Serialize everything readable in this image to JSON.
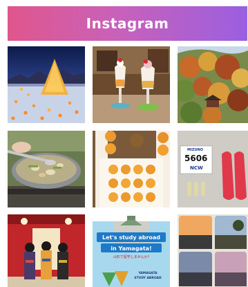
{
  "header": {
    "title": "Instagram"
  },
  "posts": {
    "bib_number": "5606",
    "bib_sub": "NCW",
    "brand": "MIZUNO",
    "poster_line1": "Let's study abroad",
    "poster_line2": "in Yamagata!",
    "poster_sub": "山形で留学しませんか?",
    "poster_foot1": "YAMAGATA",
    "poster_foot2": "STUDY ABROAD"
  }
}
